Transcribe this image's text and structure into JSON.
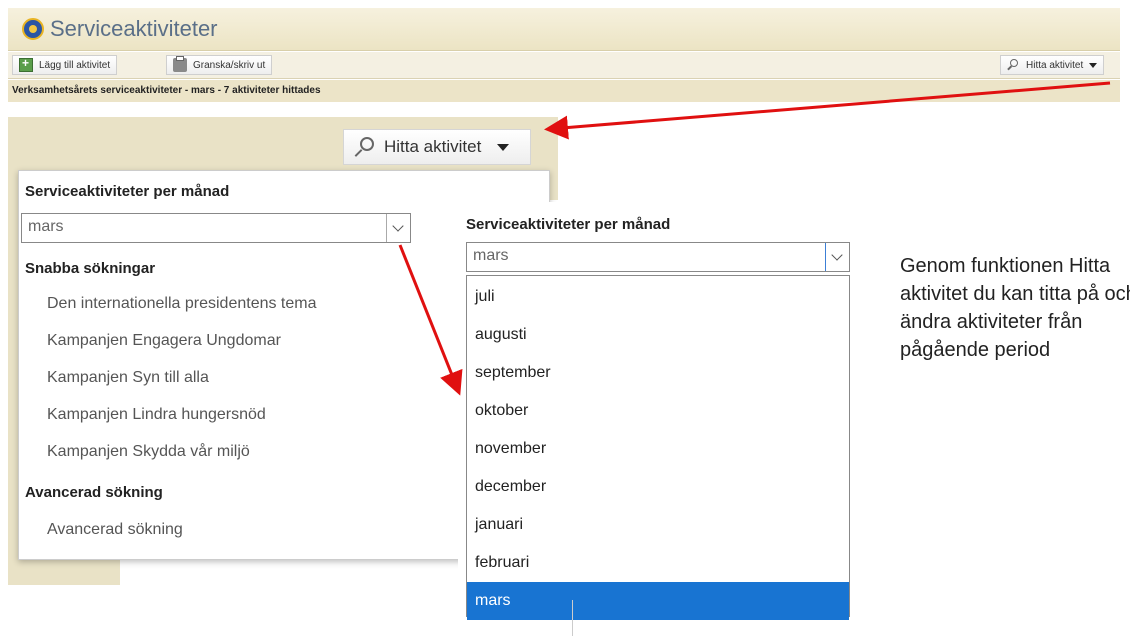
{
  "app": {
    "title": "Serviceaktiviteter",
    "toolbar": {
      "add_label": "Lägg till aktivitet",
      "print_label": "Granska/skriv ut",
      "find_label": "Hitta aktivitet"
    },
    "status": "Verksamhetsårets serviceaktiviteter - mars - 7 aktiviteter hittades"
  },
  "find_menu": {
    "button_label": "Hitta aktivitet",
    "month_heading": "Serviceaktiviteter per månad",
    "month_value": "mars",
    "quick_heading": "Snabba sökningar",
    "quick_items": [
      "Den internationella presidentens tema",
      "Kampanjen Engagera Ungdomar",
      "Kampanjen Syn till alla",
      "Kampanjen Lindra hungersnöd",
      "Kampanjen Skydda vår miljö"
    ],
    "advanced_heading": "Avancerad sökning",
    "advanced_item": "Avancerad sökning"
  },
  "dropdown": {
    "heading": "Serviceaktiviteter per månad",
    "value": "mars",
    "options": [
      "juli",
      "augusti",
      "september",
      "oktober",
      "november",
      "december",
      "januari",
      "februari",
      "mars"
    ],
    "selected": "mars"
  },
  "side_text": [
    "Genom funktionen Hitta",
    "aktivitet du kan titta på och",
    "ändra aktiviteter från",
    "pågående period"
  ],
  "colors": {
    "header_bg": "#ece4c4",
    "selected_option": "#1874d2",
    "annotation_arrow": "#e01010"
  },
  "icons": [
    "lions-logo-icon",
    "add-activity-icon",
    "print-icon",
    "search-icon",
    "chevron-down-icon"
  ]
}
